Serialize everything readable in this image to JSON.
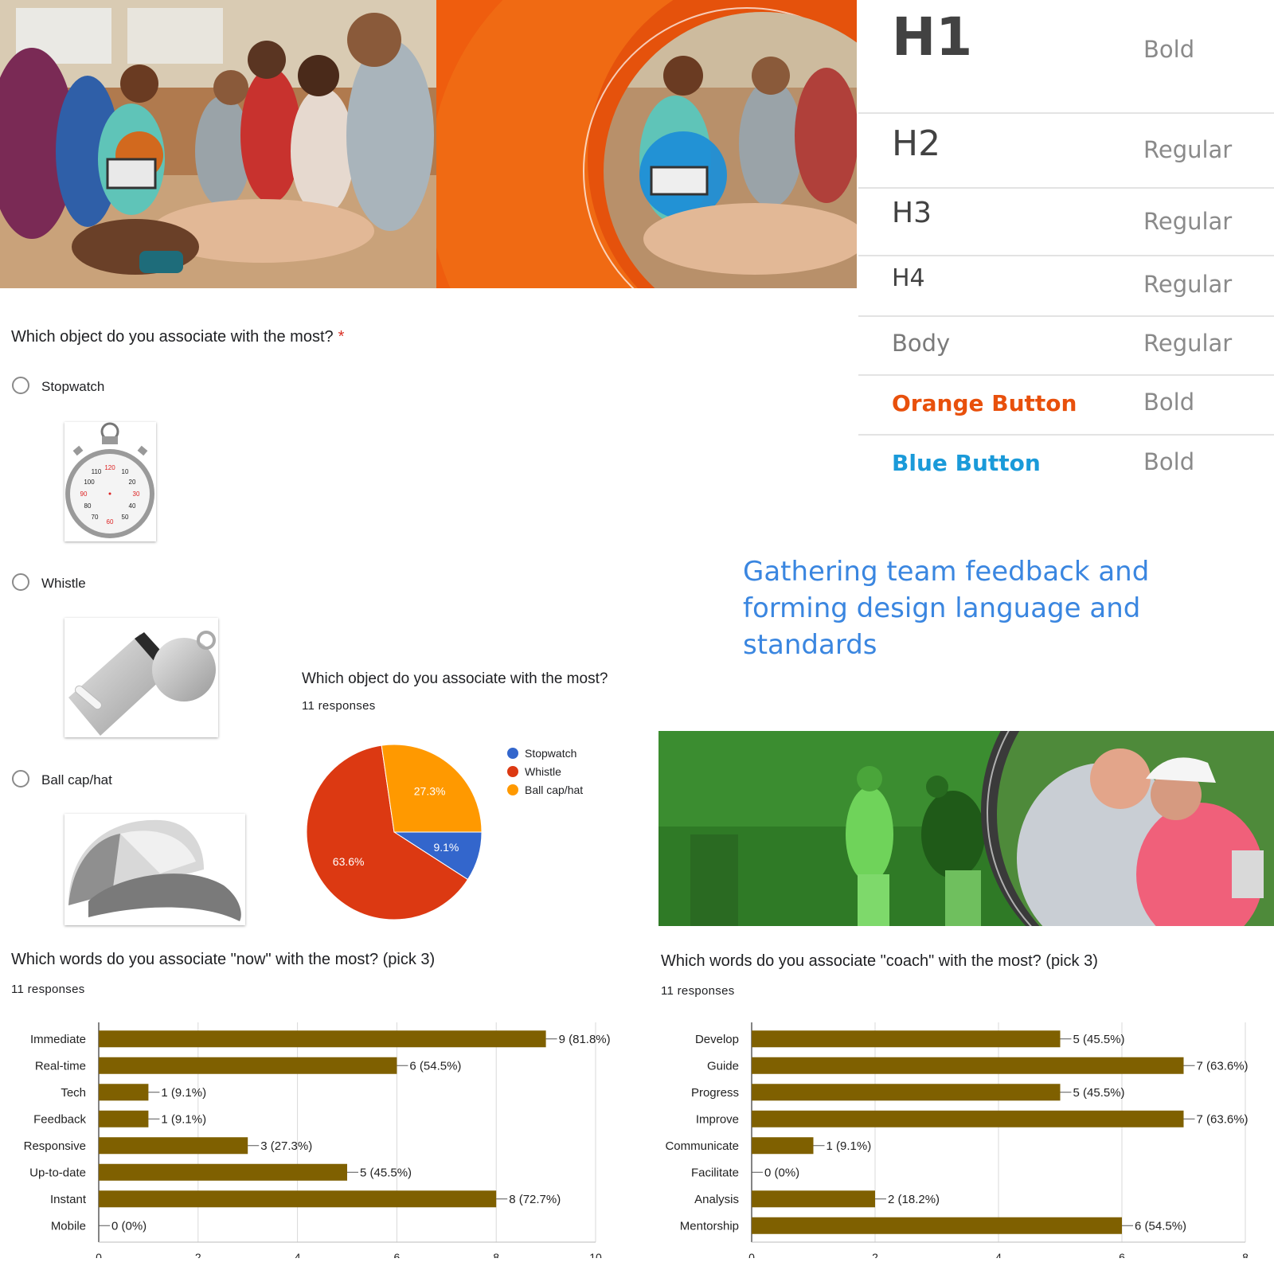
{
  "typography": {
    "rows": [
      {
        "name": "H1",
        "weight": "Bold",
        "color": "#424242"
      },
      {
        "name": "H2",
        "weight": "Regular",
        "color": "#424242"
      },
      {
        "name": "H3",
        "weight": "Regular",
        "color": "#424242"
      },
      {
        "name": "H4",
        "weight": "Regular",
        "color": "#424242"
      },
      {
        "name": "Body",
        "weight": "Regular",
        "color": "#7a7a7a"
      },
      {
        "name": "Orange Button",
        "weight": "Bold",
        "color": "#e8500c"
      },
      {
        "name": "Blue Button",
        "weight": "Bold",
        "color": "#1a9ad9"
      }
    ]
  },
  "headline": "Gathering team feedback and forming design language and standards",
  "form": {
    "question": "Which object do you associate with the most?",
    "required_mark": "*",
    "options": [
      {
        "label": "Stopwatch"
      },
      {
        "label": "Whistle"
      },
      {
        "label": "Ball cap/hat"
      }
    ],
    "stopwatch_numbers": [
      "120",
      "10",
      "20",
      "30",
      "40",
      "50",
      "60",
      "70",
      "80",
      "90",
      "100",
      "110"
    ]
  },
  "pie": {
    "title": "Which object do you associate with the most?",
    "responses": "11 responses",
    "legend": [
      {
        "label": "Stopwatch",
        "color": "#3366cc"
      },
      {
        "label": "Whistle",
        "color": "#dc3912"
      },
      {
        "label": "Ball cap/hat",
        "color": "#ff9900"
      }
    ]
  },
  "bar_now": {
    "title": "Which words do you associate \"now\" with the most? (pick 3)",
    "responses": "11 responses"
  },
  "bar_coach": {
    "title": "Which words do you associate \"coach\" with the most? (pick 3)",
    "responses": "11 responses"
  },
  "chart_data": [
    {
      "type": "pie",
      "categories": [
        "Stopwatch",
        "Whistle",
        "Ball cap/hat"
      ],
      "values": [
        9.1,
        63.6,
        27.3
      ],
      "labels": [
        "9.1%",
        "63.6%",
        "27.3%"
      ],
      "colors": [
        "#3366cc",
        "#dc3912",
        "#ff9900"
      ],
      "legend": "right"
    },
    {
      "type": "bar",
      "orientation": "horizontal",
      "categories": [
        "Immediate",
        "Real-time",
        "Tech",
        "Feedback",
        "Responsive",
        "Up-to-date",
        "Instant",
        "Mobile"
      ],
      "values": [
        9,
        6,
        1,
        1,
        3,
        5,
        8,
        0
      ],
      "labels": [
        "9 (81.8%)",
        "6 (54.5%)",
        "1 (9.1%)",
        "1 (9.1%)",
        "3 (27.3%)",
        "5 (45.5%)",
        "8 (72.7%)",
        "0 (0%)"
      ],
      "xlim": [
        0,
        10
      ],
      "xticks": [
        "0",
        "2",
        "4",
        "6",
        "8",
        "10"
      ],
      "bar_color": "#7f6000",
      "grid": true
    },
    {
      "type": "bar",
      "orientation": "horizontal",
      "categories": [
        "Develop",
        "Guide",
        "Progress",
        "Improve",
        "Communicate",
        "Facilitate",
        "Analysis",
        "Mentorship"
      ],
      "values": [
        5,
        7,
        5,
        7,
        1,
        0,
        2,
        6
      ],
      "labels": [
        "5 (45.5%)",
        "7 (63.6%)",
        "5 (45.5%)",
        "7 (63.6%)",
        "1 (9.1%)",
        "0 (0%)",
        "2 (18.2%)",
        "6 (54.5%)"
      ],
      "xlim": [
        0,
        8
      ],
      "xticks": [
        "0",
        "2",
        "4",
        "6",
        "8"
      ],
      "bar_color": "#7f6000",
      "grid": true
    }
  ]
}
